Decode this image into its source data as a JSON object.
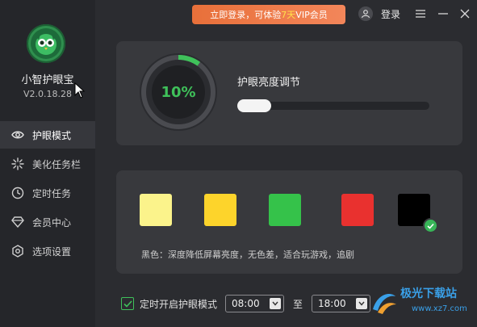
{
  "app": {
    "name": "小智护眼宝",
    "version": "V2.0.18.28"
  },
  "nav": {
    "items": [
      {
        "label": "护眼模式",
        "icon": "eye-icon",
        "active": true
      },
      {
        "label": "美化任务栏",
        "icon": "sparkle-icon",
        "active": false
      },
      {
        "label": "定时任务",
        "icon": "clock-icon",
        "active": false
      },
      {
        "label": "会员中心",
        "icon": "diamond-icon",
        "active": false
      },
      {
        "label": "选项设置",
        "icon": "gear-icon",
        "active": false
      }
    ]
  },
  "topbar": {
    "banner_prefix": "立即登录，可体验",
    "banner_highlight": "7天",
    "banner_suffix": "VIP会员",
    "login_label": "登录",
    "colors": {
      "banner": "#ee7845",
      "highlight": "#ffe04a"
    }
  },
  "brightness": {
    "value_label": "10%",
    "value": 10,
    "title": "护眼亮度调节",
    "accent": "#3fc15a"
  },
  "modes": {
    "swatches": [
      {
        "name": "light-yellow",
        "color": "#fbf38b",
        "selected": false
      },
      {
        "name": "yellow",
        "color": "#fdd42b",
        "selected": false
      },
      {
        "name": "green",
        "color": "#35c24a",
        "selected": false
      },
      {
        "name": "red",
        "color": "#e9312f",
        "selected": false
      },
      {
        "name": "black",
        "color": "#000000",
        "selected": true
      }
    ],
    "description": "黑色：深度降低屏幕亮度，无色差，适合玩游戏，追剧"
  },
  "timer": {
    "checked": true,
    "label": "定时开启护眼模式",
    "start": "08:00",
    "to_label": "至",
    "end": "18:00"
  },
  "watermark": {
    "text": "极光下载站",
    "url": "www.xz7.com"
  }
}
